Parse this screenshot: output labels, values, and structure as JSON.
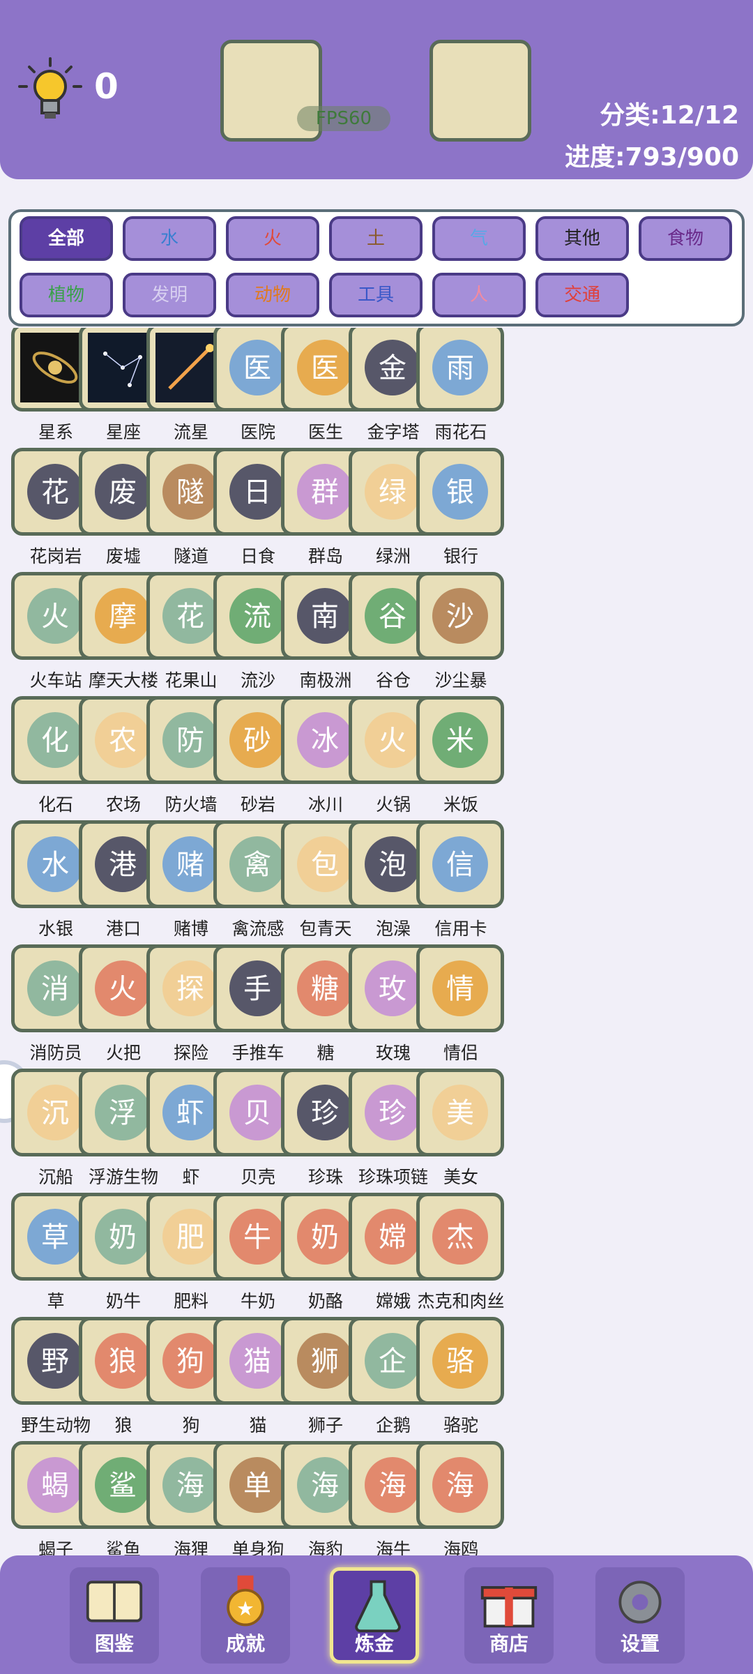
{
  "header": {
    "hint_count": "0",
    "fps_label": "FPS60",
    "category_progress": "分类:12/12",
    "progress": "进度:793/900"
  },
  "categories": [
    {
      "label": "全部",
      "color": "#ffffff",
      "active": true
    },
    {
      "label": "水",
      "color": "#3a7fd0"
    },
    {
      "label": "火",
      "color": "#e04a3a"
    },
    {
      "label": "土",
      "color": "#8a5a2a"
    },
    {
      "label": "气",
      "color": "#5aa7e6"
    },
    {
      "label": "其他",
      "color": "#222222"
    },
    {
      "label": "食物",
      "color": "#6a2a8a"
    },
    {
      "label": "植物",
      "color": "#3aa04a"
    },
    {
      "label": "发明",
      "color": "#d8d0f0"
    },
    {
      "label": "动物",
      "color": "#e07a20"
    },
    {
      "label": "工具",
      "color": "#3a58c8"
    },
    {
      "label": "人",
      "color": "#f28aa0"
    },
    {
      "label": "交通",
      "color": "#e0403a"
    }
  ],
  "items": [
    {
      "label": "星系",
      "icon": "galaxy-icon"
    },
    {
      "label": "星座",
      "icon": "constellation-icon"
    },
    {
      "label": "流星",
      "icon": "meteor-icon"
    },
    {
      "label": "医院",
      "icon": "hospital-icon"
    },
    {
      "label": "医生",
      "icon": "doctor-icon"
    },
    {
      "label": "金字塔",
      "icon": "pyramid-icon"
    },
    {
      "label": "雨花石",
      "icon": "pebbles-icon"
    },
    {
      "label": "花岗岩",
      "icon": "granite-icon"
    },
    {
      "label": "废墟",
      "icon": "ruins-icon"
    },
    {
      "label": "隧道",
      "icon": "tunnel-icon"
    },
    {
      "label": "日食",
      "icon": "eclipse-icon"
    },
    {
      "label": "群岛",
      "icon": "archipelago-icon"
    },
    {
      "label": "绿洲",
      "icon": "oasis-icon"
    },
    {
      "label": "银行",
      "icon": "bank-icon"
    },
    {
      "label": "火车站",
      "icon": "train-station-icon"
    },
    {
      "label": "摩天大楼",
      "icon": "skyscraper-icon"
    },
    {
      "label": "花果山",
      "icon": "mountain-icon"
    },
    {
      "label": "流沙",
      "icon": "quicksand-icon"
    },
    {
      "label": "南极洲",
      "icon": "antarctica-icon"
    },
    {
      "label": "谷仓",
      "icon": "barn-icon"
    },
    {
      "label": "沙尘暴",
      "icon": "sandstorm-icon"
    },
    {
      "label": "化石",
      "icon": "fossil-icon"
    },
    {
      "label": "农场",
      "icon": "farm-icon"
    },
    {
      "label": "防火墙",
      "icon": "firewall-icon"
    },
    {
      "label": "砂岩",
      "icon": "sandstone-icon"
    },
    {
      "label": "冰川",
      "icon": "glacier-icon"
    },
    {
      "label": "火锅",
      "icon": "hotpot-icon"
    },
    {
      "label": "米饭",
      "icon": "rice-icon"
    },
    {
      "label": "水银",
      "icon": "mercury-icon"
    },
    {
      "label": "港口",
      "icon": "harbor-icon"
    },
    {
      "label": "赌博",
      "icon": "gambling-chips-icon"
    },
    {
      "label": "禽流感",
      "icon": "chicken-icon"
    },
    {
      "label": "包青天",
      "icon": "judge-icon"
    },
    {
      "label": "泡澡",
      "icon": "bath-icon"
    },
    {
      "label": "信用卡",
      "icon": "credit-card-icon"
    },
    {
      "label": "消防员",
      "icon": "firefighter-icon"
    },
    {
      "label": "火把",
      "icon": "torch-icon"
    },
    {
      "label": "探险",
      "icon": "explorer-icon"
    },
    {
      "label": "手推车",
      "icon": "wheelbarrow-icon"
    },
    {
      "label": "糖",
      "icon": "sugar-icon"
    },
    {
      "label": "玫瑰",
      "icon": "rose-icon"
    },
    {
      "label": "情侣",
      "icon": "couple-icon"
    },
    {
      "label": "沉船",
      "icon": "shipwreck-icon"
    },
    {
      "label": "浮游生物",
      "icon": "plankton-icon"
    },
    {
      "label": "虾",
      "icon": "shrimp-icon"
    },
    {
      "label": "贝壳",
      "icon": "shell-icon"
    },
    {
      "label": "珍珠",
      "icon": "pearl-icon"
    },
    {
      "label": "珍珠项链",
      "icon": "necklace-icon"
    },
    {
      "label": "美女",
      "icon": "woman-icon"
    },
    {
      "label": "草",
      "icon": "grass-icon"
    },
    {
      "label": "奶牛",
      "icon": "cow-icon"
    },
    {
      "label": "肥料",
      "icon": "fertilizer-icon"
    },
    {
      "label": "牛奶",
      "icon": "milk-icon"
    },
    {
      "label": "奶酪",
      "icon": "cheese-icon"
    },
    {
      "label": "嫦娥",
      "icon": "change-icon"
    },
    {
      "label": "杰克和肉丝",
      "icon": "titanic-couple-icon"
    },
    {
      "label": "野生动物",
      "icon": "tiger-icon"
    },
    {
      "label": "狼",
      "icon": "wolf-icon"
    },
    {
      "label": "狗",
      "icon": "dog-icon"
    },
    {
      "label": "猫",
      "icon": "cat-icon"
    },
    {
      "label": "狮子",
      "icon": "lion-icon"
    },
    {
      "label": "企鹅",
      "icon": "penguin-icon"
    },
    {
      "label": "骆驼",
      "icon": "camel-icon"
    },
    {
      "label": "蝎子",
      "icon": "scorpion-icon"
    },
    {
      "label": "鲨鱼",
      "icon": "shark-icon"
    },
    {
      "label": "海狸",
      "icon": "beaver-icon"
    },
    {
      "label": "单身狗",
      "icon": "single-dog-icon"
    },
    {
      "label": "海豹",
      "icon": "seal-icon"
    },
    {
      "label": "海牛",
      "icon": "manatee-icon"
    },
    {
      "label": "海鸥",
      "icon": "seagull-icon"
    }
  ],
  "nav": [
    {
      "label": "图鉴",
      "icon": "book-icon"
    },
    {
      "label": "成就",
      "icon": "medal-icon"
    },
    {
      "label": "炼金",
      "icon": "flask-icon",
      "active": true
    },
    {
      "label": "商店",
      "icon": "gift-icon"
    },
    {
      "label": "设置",
      "icon": "gear-icon"
    }
  ],
  "colors": {
    "header": "#8d74c8",
    "tile": "#e8dfb9",
    "tile_border": "#596b58",
    "nav_active_glow": "#f1e690"
  }
}
